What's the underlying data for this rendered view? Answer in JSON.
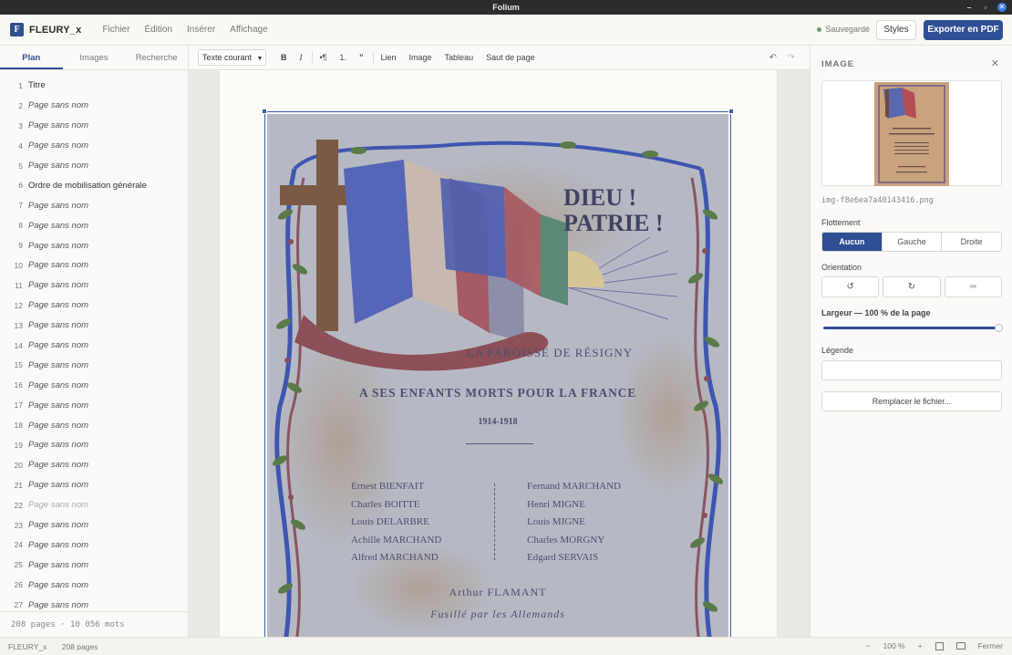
{
  "window": {
    "title": "Folium",
    "controls": [
      "–",
      "▫",
      "✕"
    ]
  },
  "app": {
    "logo_letter": "F",
    "doc_name": "FLEURY_x",
    "menus": [
      "Fichier",
      "Édition",
      "Insérer",
      "Affichage"
    ],
    "save_status": "Sauvegardé",
    "styles_label": "Styles",
    "export_label": "Exporter en PDF"
  },
  "left": {
    "tabs": [
      "Plan",
      "Images",
      "Recherche"
    ],
    "active_tab": "Plan",
    "outline": [
      {
        "n": "1",
        "t": "Titre",
        "named": true
      },
      {
        "n": "2",
        "t": "Page sans nom"
      },
      {
        "n": "3",
        "t": "Page sans nom"
      },
      {
        "n": "4",
        "t": "Page sans nom"
      },
      {
        "n": "5",
        "t": "Page sans nom"
      },
      {
        "n": "6",
        "t": "Ordre de mobilisation générale",
        "named": true
      },
      {
        "n": "7",
        "t": "Page sans nom"
      },
      {
        "n": "8",
        "t": "Page sans nom"
      },
      {
        "n": "9",
        "t": "Page sans nom"
      },
      {
        "n": "10",
        "t": "Page sans nom"
      },
      {
        "n": "11",
        "t": "Page sans nom"
      },
      {
        "n": "12",
        "t": "Page sans nom"
      },
      {
        "n": "13",
        "t": "Page sans nom"
      },
      {
        "n": "14",
        "t": "Page sans nom"
      },
      {
        "n": "15",
        "t": "Page sans nom"
      },
      {
        "n": "16",
        "t": "Page sans nom"
      },
      {
        "n": "17",
        "t": "Page sans nom"
      },
      {
        "n": "18",
        "t": "Page sans nom"
      },
      {
        "n": "19",
        "t": "Page sans nom"
      },
      {
        "n": "20",
        "t": "Page sans nom"
      },
      {
        "n": "21",
        "t": "Page sans nom"
      },
      {
        "n": "22",
        "t": "Page sans nom",
        "dim": true
      },
      {
        "n": "23",
        "t": "Page sans nom"
      },
      {
        "n": "24",
        "t": "Page sans nom"
      },
      {
        "n": "25",
        "t": "Page sans nom"
      },
      {
        "n": "26",
        "t": "Page sans nom"
      },
      {
        "n": "27",
        "t": "Page sans nom"
      }
    ],
    "footer": "208 pages · 10 056 mots"
  },
  "toolbar": {
    "style_select": "Texte courant",
    "bold": "B",
    "italic": "I",
    "bullets": "•¶",
    "numbered": "1.",
    "quote": "”",
    "link": "Lien",
    "image": "Image",
    "table": "Tableau",
    "page_break": "Saut de page",
    "undo": "↶",
    "redo": "↷"
  },
  "poster": {
    "motto_1": "DIEU !",
    "motto_2": "PATRIE !",
    "parish": "LA PAROISSE DE RÉSIGNY",
    "dedication": "A SES ENFANTS MORTS POUR LA FRANCE",
    "years": "1914-1918",
    "names_left": [
      "Ernest BIENFAIT",
      "Charles BOITTE",
      "Louis DELARBRE",
      "Achille MARCHAND",
      "Alfred MARCHAND"
    ],
    "names_right": [
      "Fernand MARCHAND",
      "Henri MIGNE",
      "Louis MIGNE",
      "Charles MORGNY",
      "Edgard SERVAIS"
    ],
    "special_name": "Arthur  FLAMANT",
    "special_note": "Fusillé par les Allemands"
  },
  "right": {
    "title": "IMAGE",
    "close": "✕",
    "filename": "img-f8e6ea7a40143416.png",
    "float_label": "Flottement",
    "float_options": [
      "Aucun",
      "Gauche",
      "Droite"
    ],
    "float_selected": "Aucun",
    "orientation_label": "Orientation",
    "orientation_buttons": [
      "↺",
      "↻",
      "⇹"
    ],
    "width_label": "Largeur — 100 % de la page",
    "width_fraction": 1.0,
    "caption_label": "Légende",
    "caption_value": "",
    "replace_label": "Remplacer le fichier..."
  },
  "status": {
    "doc": "FLEURY_x",
    "pages": "208 pages",
    "zoom_out": "−",
    "zoom": "100 %",
    "zoom_in": "+",
    "close": "Fermer"
  }
}
